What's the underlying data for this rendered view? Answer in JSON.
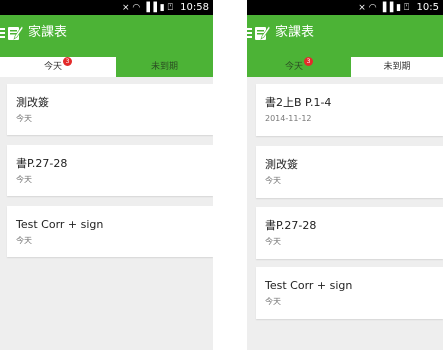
{
  "left_screen": {
    "status": {
      "time": "10:58",
      "icons": "⨯ ◠ ▐▐ ▮ ⍞"
    },
    "app_title": "家課表",
    "tabs": {
      "today": "今天",
      "today_badge": "3",
      "overdue": "未到期"
    },
    "items": [
      {
        "title": "測改簽",
        "date": "今天"
      },
      {
        "title": "書P.27-28",
        "date": "今天"
      },
      {
        "title": "Test Corr + sign",
        "date": "今天"
      }
    ]
  },
  "right_screen": {
    "status": {
      "time": "10:5",
      "icons": "⨯ ◠ ▐▐ ▮ ⍞"
    },
    "app_title": "家課表",
    "tabs": {
      "today": "今天",
      "today_badge": "3",
      "overdue": "未到期"
    },
    "items": [
      {
        "title": "書2上B P.1-4",
        "date": "2014-11-12"
      },
      {
        "title": "測改簽",
        "date": "今天"
      },
      {
        "title": "書P.27-28",
        "date": "今天"
      },
      {
        "title": "Test Corr + sign",
        "date": "今天"
      }
    ]
  },
  "colors": {
    "app_bar": "#4cb336",
    "badge": "#e32b2b",
    "background": "#eeeeee"
  },
  "icons": {
    "menu": "hamburger-icon",
    "logo": "notebook-pencil-icon",
    "battery": "battery-icon"
  }
}
